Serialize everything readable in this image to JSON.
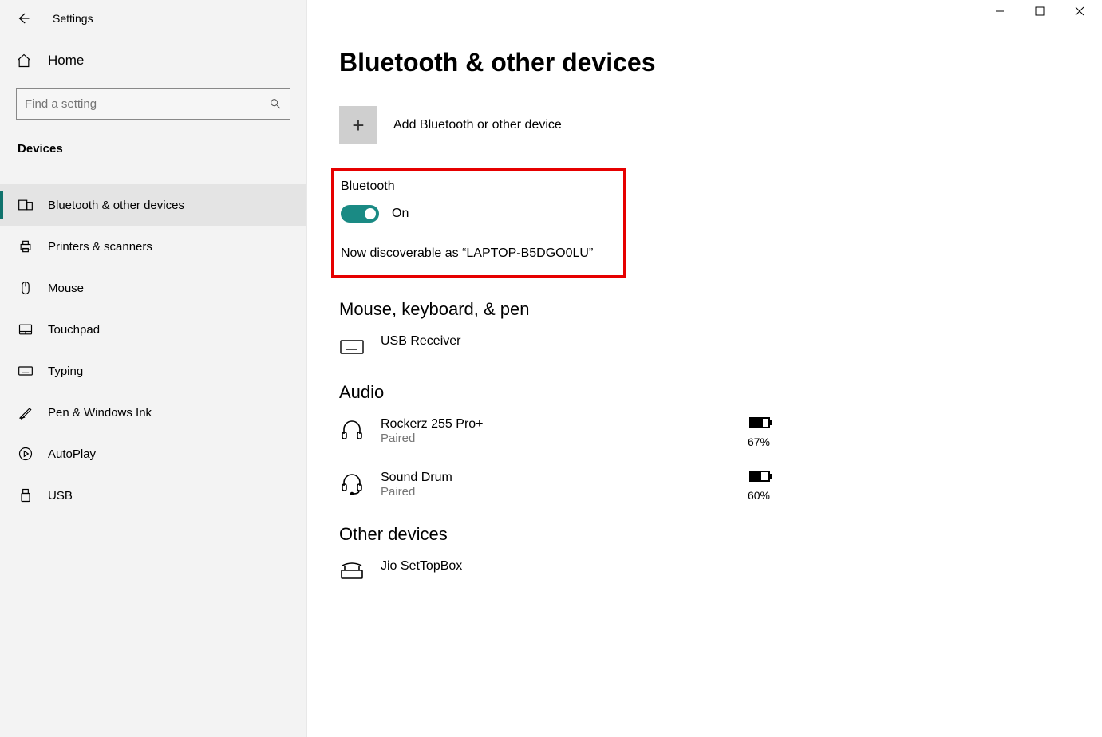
{
  "app_title": "Settings",
  "home_label": "Home",
  "search": {
    "placeholder": "Find a setting"
  },
  "category": "Devices",
  "nav": [
    {
      "label": "Bluetooth & other devices",
      "selected": true
    },
    {
      "label": "Printers & scanners",
      "selected": false
    },
    {
      "label": "Mouse",
      "selected": false
    },
    {
      "label": "Touchpad",
      "selected": false
    },
    {
      "label": "Typing",
      "selected": false
    },
    {
      "label": "Pen & Windows Ink",
      "selected": false
    },
    {
      "label": "AutoPlay",
      "selected": false
    },
    {
      "label": "USB",
      "selected": false
    }
  ],
  "page_title": "Bluetooth & other devices",
  "add_label": "Add Bluetooth or other device",
  "bluetooth": {
    "heading": "Bluetooth",
    "state": "On",
    "discoverable": "Now discoverable as “LAPTOP-B5DGO0LU”"
  },
  "section_mouse": "Mouse, keyboard, & pen",
  "usb_receiver": {
    "name": "USB Receiver"
  },
  "section_audio": "Audio",
  "audio_devices": [
    {
      "name": "Rockerz 255 Pro+",
      "status": "Paired",
      "battery": "67%",
      "fill": 67
    },
    {
      "name": "Sound Drum",
      "status": "Paired",
      "battery": "60%",
      "fill": 60
    }
  ],
  "section_other": "Other devices",
  "other_devices": [
    {
      "name": "Jio SetTopBox"
    }
  ]
}
